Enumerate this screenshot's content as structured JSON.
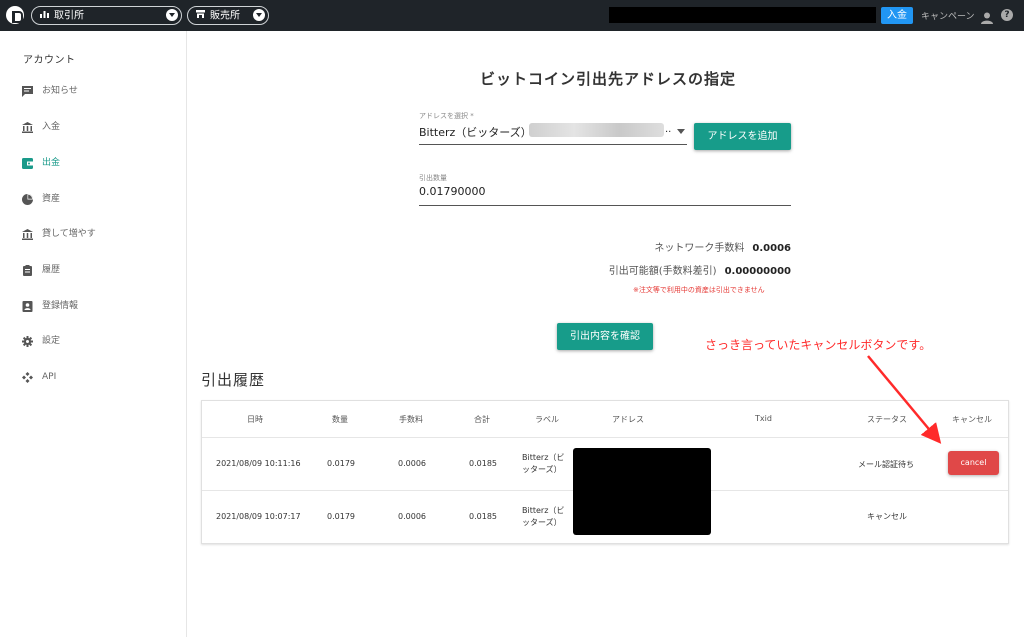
{
  "topbar": {
    "nav_exchange": "取引所",
    "nav_sales": "販売所",
    "deposit_label": "入金",
    "campaign_label": "キャンペーン",
    "help_label": "?"
  },
  "sidebar": {
    "title": "アカウント",
    "items": [
      {
        "label": "お知らせ",
        "icon": "message-icon"
      },
      {
        "label": "入金",
        "icon": "bank-icon"
      },
      {
        "label": "出金",
        "icon": "wallet-icon"
      },
      {
        "label": "資産",
        "icon": "pie-chart-icon"
      },
      {
        "label": "貸して増やす",
        "icon": "bank-icon"
      },
      {
        "label": "履歴",
        "icon": "clipboard-icon"
      },
      {
        "label": "登録情報",
        "icon": "id-card-icon"
      },
      {
        "label": "設定",
        "icon": "gear-icon"
      },
      {
        "label": "API",
        "icon": "api-icon"
      }
    ],
    "active_index": 2
  },
  "form": {
    "title": "ビットコイン引出先アドレスの指定",
    "address_label": "アドレスを選択 *",
    "address_value": "Bitterz（ビッターズ）-",
    "address_suffix": "..",
    "add_address_button": "アドレスを追加",
    "amount_label": "引出数量",
    "amount_value": "0.01790000",
    "network_fee_label": "ネットワーク手数料",
    "network_fee_value": "0.0006",
    "available_label": "引出可能額(手数料差引)",
    "available_value": "0.00000000",
    "warning": "※注文等で利用中の資産は引出できません",
    "confirm_button": "引出内容を確認"
  },
  "history": {
    "title": "引出履歴",
    "columns": [
      "日時",
      "数量",
      "手数料",
      "合計",
      "ラベル",
      "アドレス",
      "Txid",
      "ステータス",
      "キャンセル"
    ],
    "rows": [
      {
        "datetime": "2021/08/09 10:11:16",
        "amount": "0.0179",
        "fee": "0.0006",
        "total": "0.0185",
        "label": "Bitterz（ビッターズ）",
        "status": "メール認証待ち",
        "cancel": "cancel"
      },
      {
        "datetime": "2021/08/09 10:07:17",
        "amount": "0.0179",
        "fee": "0.0006",
        "total": "0.0185",
        "label": "Bitterz（ビッターズ）",
        "status": "キャンセル",
        "cancel": ""
      }
    ]
  },
  "annotation": "さっき言っていたキャンセルボタンです。",
  "colors": {
    "topbar": "#1f2429",
    "accent": "#179c8a",
    "deposit": "#2196f3",
    "cancel": "#e04848",
    "annotation": "#ff2a2a"
  }
}
